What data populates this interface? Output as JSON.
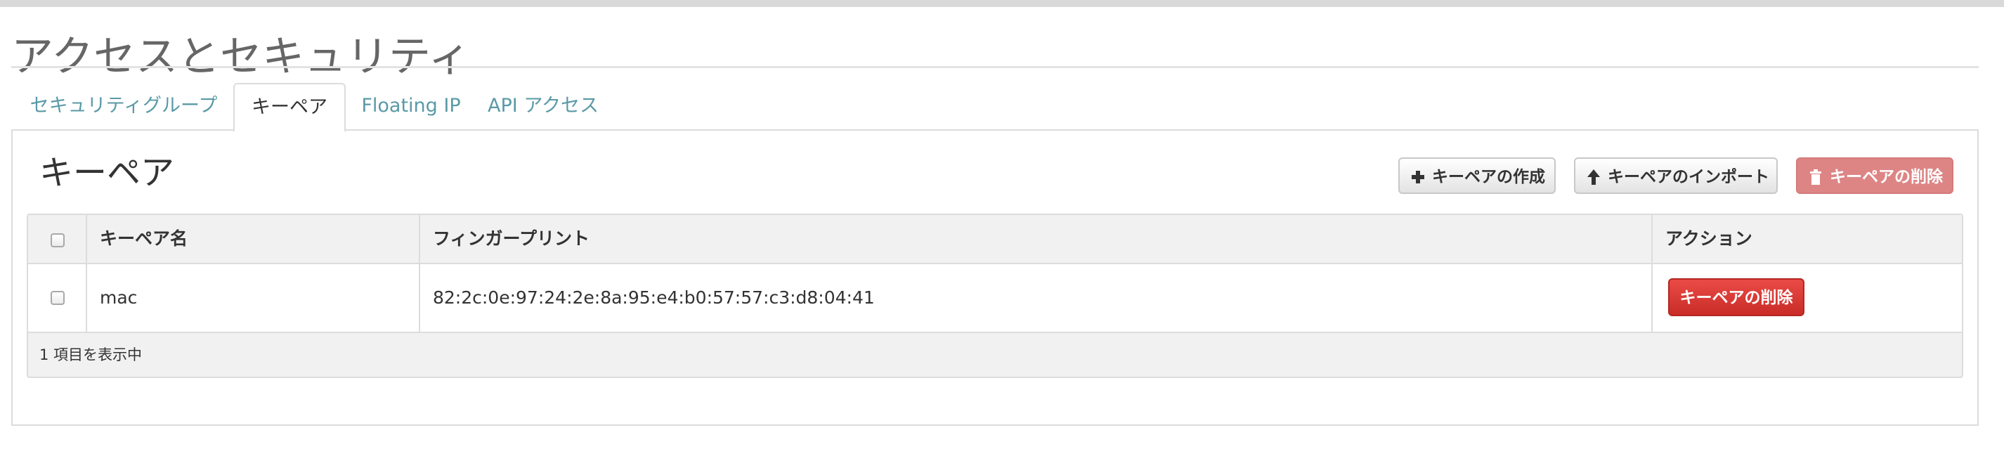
{
  "page": {
    "title": "アクセスとセキュリティ"
  },
  "tabs": [
    {
      "label": "セキュリティグループ",
      "active": false
    },
    {
      "label": "キーペア",
      "active": true
    },
    {
      "label": "Floating IP",
      "active": false
    },
    {
      "label": "API アクセス",
      "active": false
    }
  ],
  "panel": {
    "title": "キーペア",
    "actions": {
      "create": {
        "label": "キーペアの作成",
        "icon": "plus-icon"
      },
      "import": {
        "label": "キーペアのインポート",
        "icon": "arrow-up-icon"
      },
      "delete": {
        "label": "キーペアの削除",
        "icon": "trash-icon",
        "disabled": true
      }
    }
  },
  "table": {
    "columns": [
      "キーペア名",
      "フィンガープリント",
      "アクション"
    ],
    "rows": [
      {
        "name": "mac",
        "fingerprint": "82:2c:0e:97:24:2e:8a:95:e4:b0:57:57:c3:d8:04:41",
        "action": "キーペアの削除"
      }
    ],
    "footer": "1 項目を表示中"
  },
  "colors": {
    "link": "#5a9aa6",
    "danger": "#d9403a",
    "danger_disabled": "#dd8585"
  }
}
